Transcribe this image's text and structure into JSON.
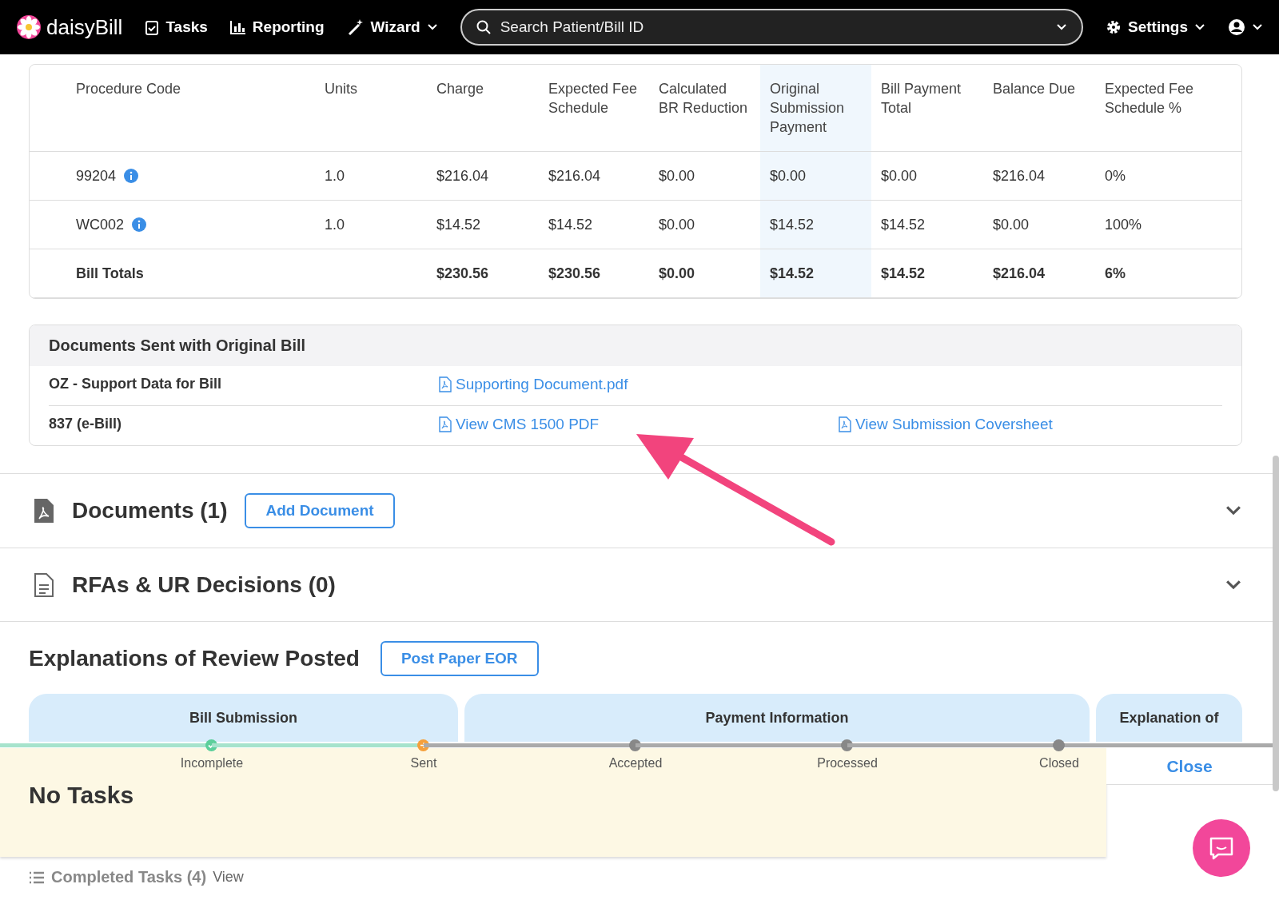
{
  "nav": {
    "logo": "daisyBill",
    "items": [
      {
        "label": "Tasks",
        "kind": "tasks",
        "dropdown": false
      },
      {
        "label": "Reporting",
        "kind": "reporting",
        "dropdown": false
      },
      {
        "label": "Wizard",
        "kind": "wizard",
        "dropdown": true
      }
    ],
    "search": {
      "placeholder": "Search Patient/Bill ID"
    },
    "settings": "Settings"
  },
  "table": {
    "columns": [
      {
        "label": "Procedure Code",
        "highlighted": false
      },
      {
        "label": "Units",
        "highlighted": false
      },
      {
        "label": "Charge",
        "highlighted": false
      },
      {
        "label": "Expected Fee Schedule",
        "highlighted": false
      },
      {
        "label": "Calculated BR Reduction",
        "highlighted": false
      },
      {
        "label": "Original Submission Payment",
        "highlighted": true
      },
      {
        "label": "Bill Payment Total",
        "highlighted": false
      },
      {
        "label": "Balance Due",
        "highlighted": false
      },
      {
        "label": "Expected Fee Schedule %",
        "highlighted": false
      }
    ],
    "rows": [
      {
        "info": true,
        "total": false,
        "cells": [
          "99204",
          "1.0",
          "$216.04",
          "$216.04",
          "$0.00",
          "$0.00",
          "$0.00",
          "$216.04",
          "0%"
        ]
      },
      {
        "info": true,
        "total": false,
        "cells": [
          "WC002",
          "1.0",
          "$14.52",
          "$14.52",
          "$0.00",
          "$14.52",
          "$14.52",
          "$0.00",
          "100%"
        ]
      },
      {
        "info": false,
        "total": true,
        "cells": [
          "Bill Totals",
          "",
          "$230.56",
          "$230.56",
          "$0.00",
          "$14.52",
          "$14.52",
          "$216.04",
          "6%"
        ]
      }
    ]
  },
  "documents_sent": {
    "title": "Documents Sent with Original Bill",
    "rows": [
      {
        "label": "OZ - Support Data for Bill",
        "links": [
          "Supporting Document.pdf"
        ]
      },
      {
        "label": "837 (e-Bill)",
        "links": [
          "View CMS 1500 PDF",
          "View Submission Coversheet"
        ]
      }
    ]
  },
  "sections": [
    {
      "title": "Documents (1)",
      "kind": "pdf",
      "button": "Add Document"
    },
    {
      "title": "RFAs & UR Decisions (0)",
      "kind": "file"
    }
  ],
  "eor": {
    "title": "Explanations of Review Posted",
    "button": "Post Paper EOR",
    "tabs": [
      "Bill Submission",
      "Payment Information",
      "Explanation of"
    ]
  },
  "tracker": [
    {
      "label": "Incomplete",
      "done": true,
      "current": false
    },
    {
      "label": "Sent",
      "done": false,
      "current": true
    },
    {
      "label": "Accepted",
      "done": false,
      "current": false
    },
    {
      "label": "Processed",
      "done": false,
      "current": false
    },
    {
      "label": "Closed",
      "done": false,
      "current": false
    }
  ],
  "tasks": {
    "title": "No Tasks",
    "close": "Close",
    "completed": "Completed Tasks (4)",
    "view": "View"
  }
}
